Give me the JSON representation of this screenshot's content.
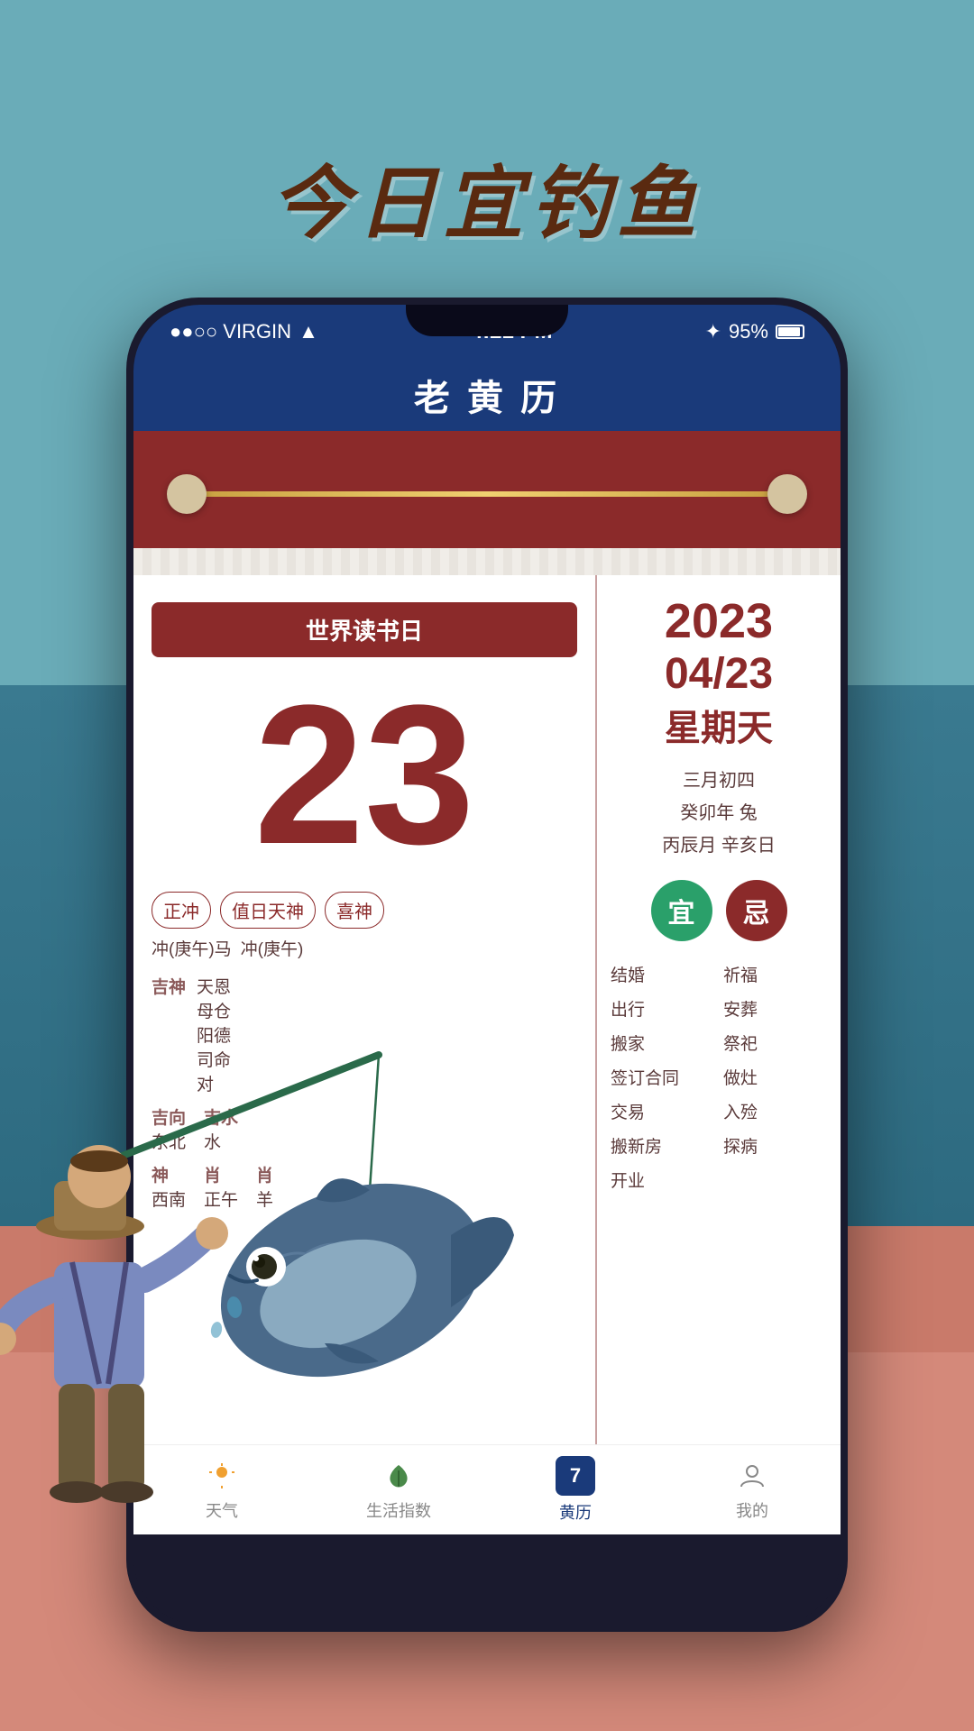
{
  "background": {
    "top_color": "#6aacb8",
    "ocean_color": "#3a7a90",
    "sand_color": "#c97a6a"
  },
  "main_title": "今日宜钓鱼",
  "phone": {
    "status_bar": {
      "carrier": "●●○○ VIRGIN",
      "wifi": "WiFi",
      "time": "4:21 PM",
      "bluetooth": "BT",
      "battery": "95%"
    },
    "app_title": "老 黄 历",
    "calendar": {
      "special_day": "世界读书日",
      "day_number": "23",
      "year": "2023",
      "month_day": "04/23",
      "weekday": "星期天",
      "lunar": {
        "line1": "三月初四",
        "line2": "癸卯年 兔",
        "line3": "丙辰月 辛亥日"
      },
      "tags": {
        "zhongchong": "正冲",
        "zhiri_tianshen": "值日天神",
        "xi_shen": "喜神"
      },
      "chong_left": "冲(庚午)马",
      "chong_right": "冲(庚午)",
      "good_gods": {
        "label": "吉神",
        "values": "天恩\n母仓\n阳德\n司命\n对"
      },
      "good_direction": {
        "label": "吉向",
        "value": "东北"
      },
      "good_water": {
        "label": "吉水",
        "value": "水"
      },
      "bad_gods": {
        "label": "神",
        "value": "西南"
      },
      "good_zodiac": {
        "label": "肖",
        "value": "羊"
      },
      "yi_label": "宜",
      "ji_label": "忌",
      "yi_items": [
        "结婚",
        "出行",
        "搬家",
        "签订合同",
        "交易",
        "搬新房",
        "开业"
      ],
      "ji_items": [
        "祈福",
        "安葬",
        "祭祀",
        "做灶",
        "入殓",
        "探病"
      ]
    },
    "bottom_nav": {
      "items": [
        {
          "label": "天气",
          "icon": "sun"
        },
        {
          "label": "生活指数",
          "icon": "leaf"
        },
        {
          "label": "黄历",
          "icon": "calendar",
          "active": true
        },
        {
          "label": "我的",
          "icon": "person"
        }
      ]
    }
  }
}
